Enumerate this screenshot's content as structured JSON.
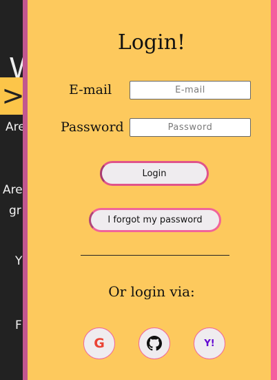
{
  "background": {
    "heading": "W",
    "arrow": ">",
    "lines": [
      "Are",
      "Are",
      "gr",
      "Y",
      "F"
    ]
  },
  "login": {
    "title": "Login!",
    "email_label": "E-mail",
    "email_placeholder": "E-mail",
    "email_value": "",
    "password_label": "Password",
    "password_placeholder": "Password",
    "password_value": "",
    "login_button": "Login",
    "forgot_button": "I forgot my password",
    "or_text": "Or login via:"
  },
  "social": [
    {
      "name": "google",
      "icon": "google-icon",
      "glyph": "G"
    },
    {
      "name": "github",
      "icon": "github-icon"
    },
    {
      "name": "yahoo",
      "icon": "yahoo-icon",
      "glyph": "Y!"
    }
  ],
  "colors": {
    "panel": "#fdc95d",
    "accent": "#f45ea0",
    "accent_dark": "#c2578f",
    "page_bg": "#222222"
  }
}
